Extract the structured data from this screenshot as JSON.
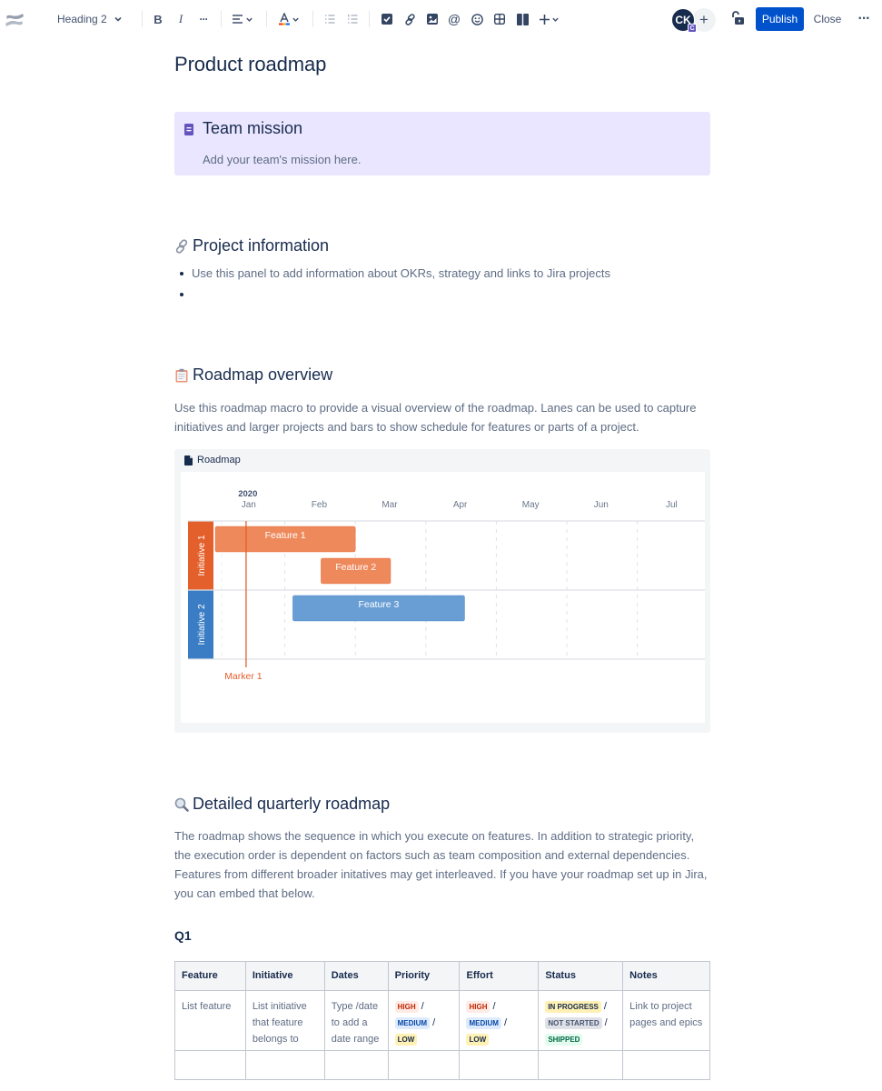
{
  "toolbar": {
    "logo_icon": "confluence-logo-icon",
    "text_style": "Heading 2",
    "items": [
      {
        "name": "bold",
        "glyph": "B"
      },
      {
        "name": "italic",
        "glyph": "I"
      },
      {
        "name": "more-formatting",
        "glyph": "···"
      },
      {
        "name": "alignment",
        "glyph": "align-left"
      },
      {
        "name": "text-color",
        "glyph": "A"
      },
      {
        "name": "bullet-list",
        "glyph": "bullet-list"
      },
      {
        "name": "numbered-list",
        "glyph": "numbered-list"
      },
      {
        "name": "action-item",
        "glyph": "checkbox"
      },
      {
        "name": "link",
        "glyph": "link"
      },
      {
        "name": "image",
        "glyph": "image"
      },
      {
        "name": "mention",
        "glyph": "@"
      },
      {
        "name": "emoji",
        "glyph": "emoji"
      },
      {
        "name": "table",
        "glyph": "table"
      },
      {
        "name": "layouts",
        "glyph": "layouts"
      },
      {
        "name": "insert",
        "glyph": "+"
      }
    ],
    "avatar_initials": "CK",
    "avatar_badge": "C",
    "add_collaborator": "+",
    "publish_label": "Publish",
    "close_label": "Close",
    "more_label": "···"
  },
  "page": {
    "title": "Product roadmap",
    "mission": {
      "title": "Team mission",
      "text": "Add your team's mission here."
    },
    "project_info": {
      "heading": "Project information",
      "bullets": [
        "Use this panel to add information about OKRs, strategy and links to Jira projects",
        ""
      ]
    },
    "overview": {
      "heading": "Roadmap overview",
      "text": "Use this roadmap macro to provide a visual overview of the roadmap. Lanes can be used to capture initiatives and larger projects and bars to show schedule for features or parts of a project.",
      "macro_label": "Roadmap"
    },
    "detailed": {
      "heading": "Detailed quarterly roadmap",
      "text": "The roadmap shows the sequence in which you execute on features. In addition to strategic priority, the execution order is dependent on factors such as team composition and external dependencies. Features from different broader initatives may get interleaved. If you have your roadmap set up in Jira, you can embed that below.",
      "quarter": "Q1",
      "table": {
        "headers": [
          "Feature",
          "Initiative",
          "Dates",
          "Priority",
          "Effort",
          "Status",
          "Notes"
        ],
        "row": {
          "feature": "List feature",
          "initiative": "List initiative that feature belongs to",
          "dates": "Type /date to add a date range",
          "priority": [
            {
              "label": "HIGH",
              "tone": "red"
            },
            {
              "label": "MEDIUM",
              "tone": "blue"
            },
            {
              "label": "LOW",
              "tone": "yellow"
            }
          ],
          "effort": [
            {
              "label": "HIGH",
              "tone": "red"
            },
            {
              "label": "MEDIUM",
              "tone": "blue"
            },
            {
              "label": "LOW",
              "tone": "yellow"
            }
          ],
          "status": [
            {
              "label": "IN PROGRESS",
              "tone": "yellow"
            },
            {
              "label": "NOT STARTED",
              "tone": "grey"
            },
            {
              "label": "SHIPPED",
              "tone": "green"
            }
          ],
          "notes": "Link to project pages and epics"
        },
        "separator": "/"
      }
    }
  },
  "chart_data": {
    "type": "gantt",
    "title": "Roadmap",
    "year_label": "2020",
    "time_unit": "months since Jan 1 2020",
    "months": [
      "Jan",
      "Feb",
      "Mar",
      "Apr",
      "May",
      "Jun",
      "Jul"
    ],
    "range": [
      0,
      6.85
    ],
    "grid": true,
    "lanes": [
      {
        "name": "Initiative 1",
        "color": "#e35f2b",
        "bar_color": "#ee895c",
        "bars": [
          {
            "label": "Feature 1",
            "start": 0.0,
            "end": 2.0,
            "row": 0
          },
          {
            "label": "Feature 2",
            "start": 1.5,
            "end": 2.5,
            "row": 1
          }
        ]
      },
      {
        "name": "Initiative 2",
        "color": "#3b7dc4",
        "bar_color": "#699ed5",
        "bars": [
          {
            "label": "Feature 3",
            "start": 1.1,
            "end": 3.55,
            "row": 0
          }
        ]
      }
    ],
    "markers": [
      {
        "label": "Marker 1",
        "at": 0.45,
        "color": "#e35f2b"
      }
    ]
  }
}
